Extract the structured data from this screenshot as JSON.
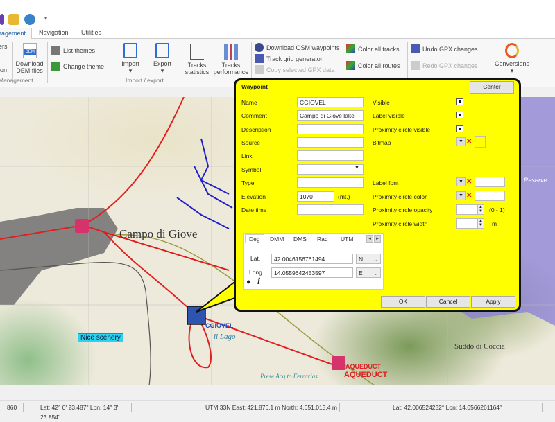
{
  "app": {
    "tabs": [
      {
        "label": "Management"
      },
      {
        "label": "Navigation"
      },
      {
        "label": "Utilities"
      }
    ]
  },
  "ribbon": {
    "layers_partial": "ers",
    "option_partial": "ion",
    "download_dem": "Download DEM files",
    "dem_badge": "DEM",
    "list_themes": "List themes",
    "change_theme": "Change theme",
    "management_group": "Management",
    "import": "Import",
    "export": "Export",
    "import_export_group": "Import / export",
    "tracks_statistics": "Tracks statistics",
    "tracks_performance": "Tracks performance",
    "download_osm": "Download OSM waypoints",
    "track_grid": "Track grid generator",
    "copy_gpx": "Copy selected GPX data",
    "color_tracks": "Color all tracks",
    "color_routes": "Color all routes",
    "undo": "Undo GPX changes",
    "redo": "Redo GPX changes",
    "conversions": "Conversions"
  },
  "map": {
    "labels": {
      "town": "Campo di Giove",
      "nice": "Nice scenery",
      "cgiovel": "CGIOVEL",
      "lago": "il Lago",
      "aqueduct1": "AQUEDUCT",
      "aqueduct2": "AQUEDUCT",
      "suddo": "Suddo di Coccia",
      "prese": "Prese Acq.to Ferrarias",
      "reserve": "Reserve"
    },
    "colors": {
      "track": "#e02020",
      "route": "#2020c8",
      "waypoint": "#d6336c",
      "purple_area": "#8a7fd8"
    }
  },
  "waypoint": {
    "title": "Waypoint",
    "center": "Center",
    "fields": {
      "name": "Name",
      "comment": "Comment",
      "description": "Description",
      "source": "Source",
      "link": "Link",
      "symbol": "Symbol",
      "type": "Type",
      "elevation": "Elevation",
      "datetime": "Date time"
    },
    "values": {
      "name": "CGIOVEL",
      "comment": "Campo di Giove lake",
      "description": "",
      "source": "",
      "link": "",
      "symbol": "",
      "type": "",
      "elevation": "1070",
      "datetime": ""
    },
    "elevation_unit": "(mt.)",
    "right": {
      "visible": "Visible",
      "label_visible": "Label visible",
      "prox_visible": "Proximity circle visible",
      "bitmap": "Bitmap",
      "label_font": "Label font",
      "prox_color": "Proximity circle color",
      "prox_opacity": "Proximity circle opacity",
      "opacity_range": "(0 - 1)",
      "prox_width": "Proximity circle width",
      "width_unit": "m"
    },
    "checked": {
      "visible": true,
      "label_visible": true,
      "prox_visible": true
    },
    "coord_tabs": [
      "Deg",
      "DMM",
      "DMS",
      "Rad",
      "UTM"
    ],
    "lat_label": "Lat.",
    "long_label": "Long.",
    "lat": "42.0046156761494",
    "lat_hem": "N",
    "long": "14.0559642453597",
    "long_hem": "E",
    "ok": "OK",
    "cancel": "Cancel",
    "apply": "Apply"
  },
  "status": {
    "elev": "860",
    "dms": "Lat: 42° 0' 23.487\"  Lon: 14° 3' 23.854\"",
    "utm": "UTM 33N  East: 421,876.1 m  North: 4,651,013.4 m",
    "deg": "Lat: 42.006524232°  Lon: 14.0566261164°"
  }
}
